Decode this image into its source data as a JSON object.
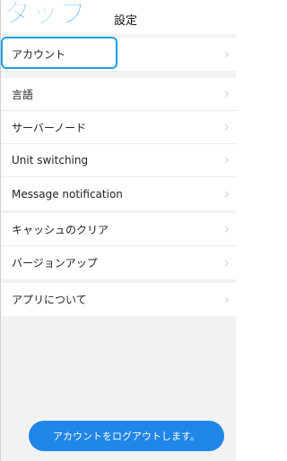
{
  "annotation": {
    "tap_label": "タップ"
  },
  "header": {
    "title": "設定"
  },
  "groups": [
    {
      "items": [
        {
          "label": "アカウント"
        }
      ]
    },
    {
      "items": [
        {
          "label": "言語"
        },
        {
          "label": "サーバーノード"
        },
        {
          "label": "Unit switching"
        },
        {
          "label": "Message notification"
        }
      ]
    },
    {
      "items": [
        {
          "label": "キャッシュのクリア"
        },
        {
          "label": "バージョンアップ"
        }
      ]
    },
    {
      "items": [
        {
          "label": "アプリについて"
        }
      ]
    }
  ],
  "logout": {
    "label": "アカウントをログアウトします。"
  },
  "colors": {
    "accent": "#1f86e8",
    "annotation": "#1aa0e6",
    "background": "#f2f2f2"
  },
  "icons": {
    "chevron": "chevron-right-icon"
  }
}
